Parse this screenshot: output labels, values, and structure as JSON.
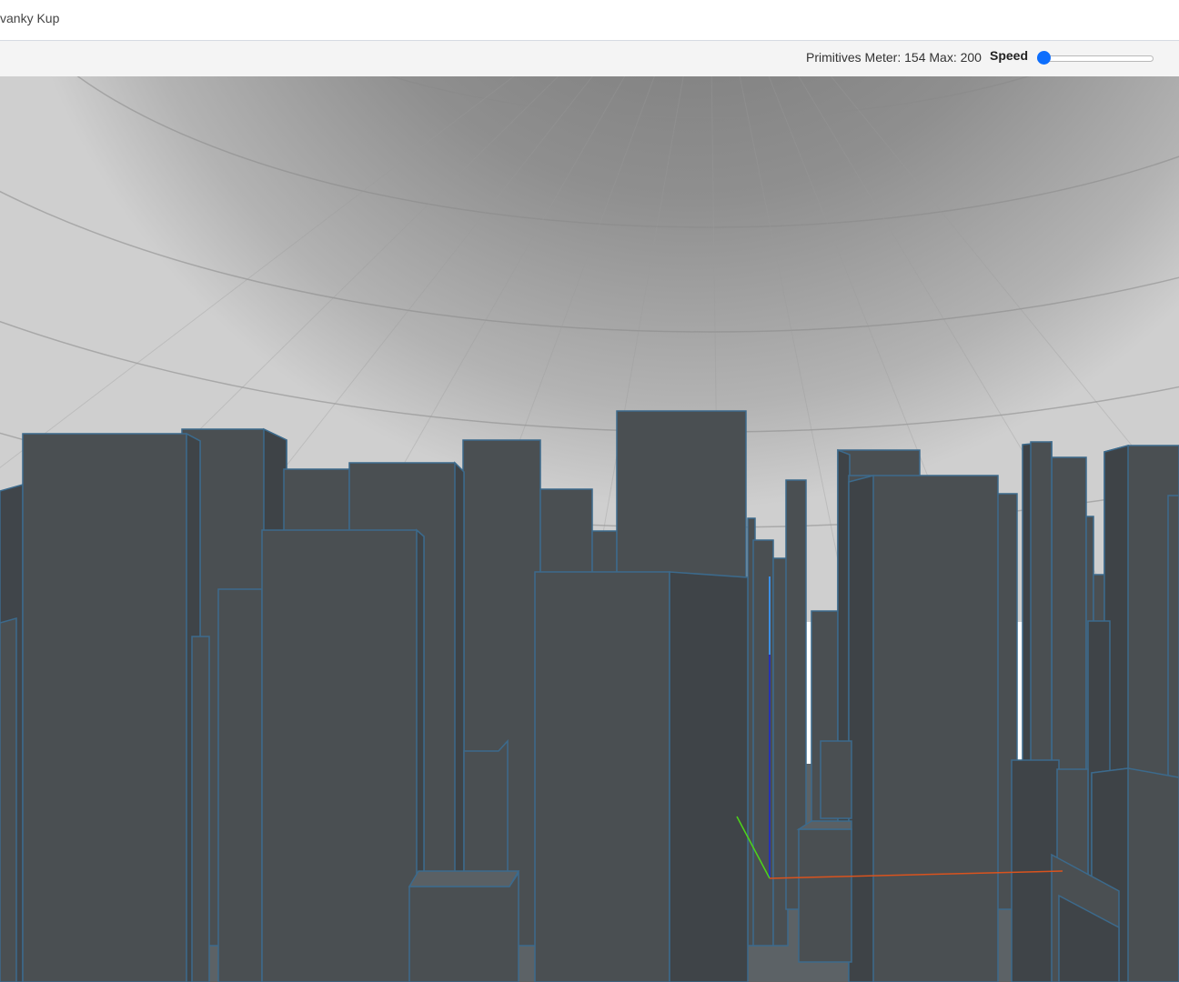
{
  "window": {
    "title": "vanky Kup"
  },
  "toolbar": {
    "primitives_meter": "Primitives Meter: 154 Max: 200",
    "speed_label": "Speed",
    "speed_value_fraction": 0.0
  },
  "scene": {
    "type": "3d-city-viewport",
    "building_color": "#4a4f52",
    "building_edge_color": "#3c6a8c",
    "sky_dome_color": "#9a9a9a",
    "ground_color": "#5c6266",
    "axis_colors": {
      "x": "#d9531e",
      "y": "#4cd51a",
      "z": "#1a2ad5"
    }
  }
}
